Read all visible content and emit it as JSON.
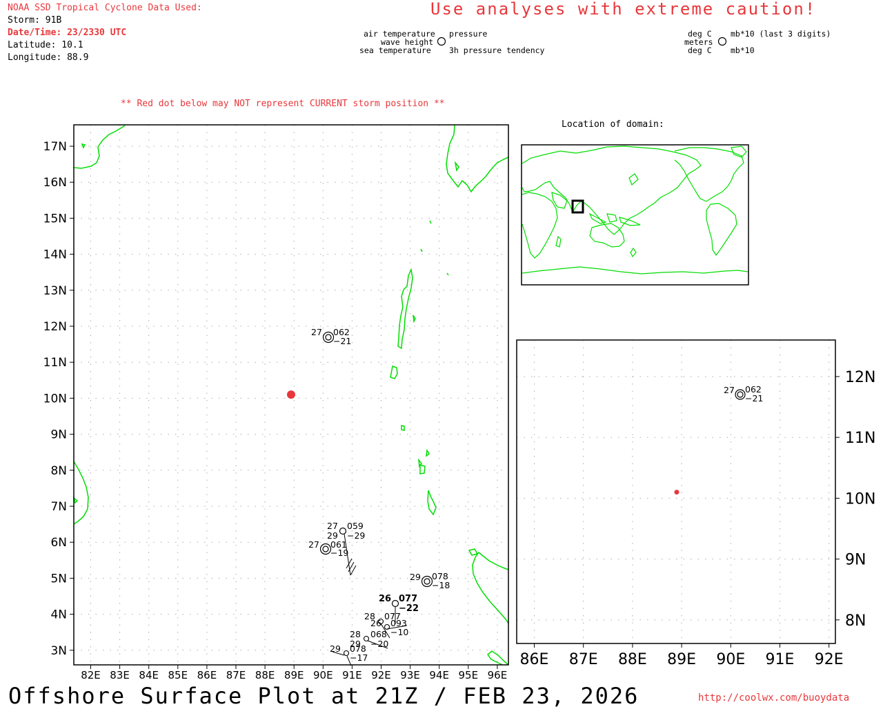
{
  "header": {
    "source": "NOAA SSD Tropical Cyclone Data Used:",
    "storm": "Storm: 91B",
    "datetime": "Date/Time: 23/2330 UTC",
    "latitude": "Latitude: 10.1",
    "longitude": "Longitude: 88.9",
    "caution": "Use analyses with extreme caution!",
    "red_dot_note": "** Red dot below may NOT represent CURRENT storm position **"
  },
  "legend": {
    "left_top": "air temperature",
    "left_mid": "wave height",
    "left_bot": "sea temperature",
    "right_top": "pressure",
    "right_bot": "3h pressure tendency",
    "units_left_top": "deg C",
    "units_left_mid": "meters",
    "units_left_bot": "deg C",
    "units_right_top": "mb*10 (last 3 digits)",
    "units_right_bot": "mb*10"
  },
  "inset": {
    "title": "Location of domain:"
  },
  "main_map": {
    "lat_labels": [
      "17N",
      "16N",
      "15N",
      "14N",
      "13N",
      "12N",
      "11N",
      "10N",
      "9N",
      "8N",
      "7N",
      "6N",
      "5N",
      "4N",
      "3N"
    ],
    "lon_labels": [
      "82E",
      "83E",
      "84E",
      "85E",
      "86E",
      "87E",
      "88E",
      "89E",
      "90E",
      "91E",
      "92E",
      "93E",
      "94E",
      "95E",
      "96E"
    ],
    "storm": {
      "lat": 10.1,
      "lon": 88.9,
      "color": "#e8373b"
    }
  },
  "zoom_map": {
    "lat_labels": [
      "12N",
      "11N",
      "10N",
      "9N",
      "8N"
    ],
    "lon_labels": [
      "86E",
      "87E",
      "88E",
      "89E",
      "90E",
      "91E",
      "92E"
    ]
  },
  "observations": [
    {
      "at": "27",
      "pr": "062",
      "tend": "−21"
    },
    {
      "at": "27",
      "pr": "059",
      "st": "29",
      "tend": "−29"
    },
    {
      "at": "27",
      "pr": "061",
      "tend": "−19"
    },
    {
      "at": "29",
      "pr": "078",
      "tend": "−18"
    },
    {
      "at": "26",
      "pr": "077",
      "tend": "−22"
    },
    {
      "at": "28",
      "pr": "077"
    },
    {
      "at": "26",
      "pr": "093",
      "tend": "−10"
    },
    {
      "at": "28",
      "pr": "068",
      "st": "29",
      "tend": "−20"
    },
    {
      "at": "29",
      "pr": "078",
      "tend": "−17"
    }
  ],
  "zoom_observation": {
    "at": "27",
    "pr": "062",
    "tend": "−21"
  },
  "footer": {
    "title": "Offshore Surface Plot at 21Z / FEB 23, 2026",
    "url": "http://coolwx.com/buoydata"
  },
  "colors": {
    "coast": "#00dd00",
    "accent": "#e8373b",
    "grid": "#aaaaaa"
  }
}
